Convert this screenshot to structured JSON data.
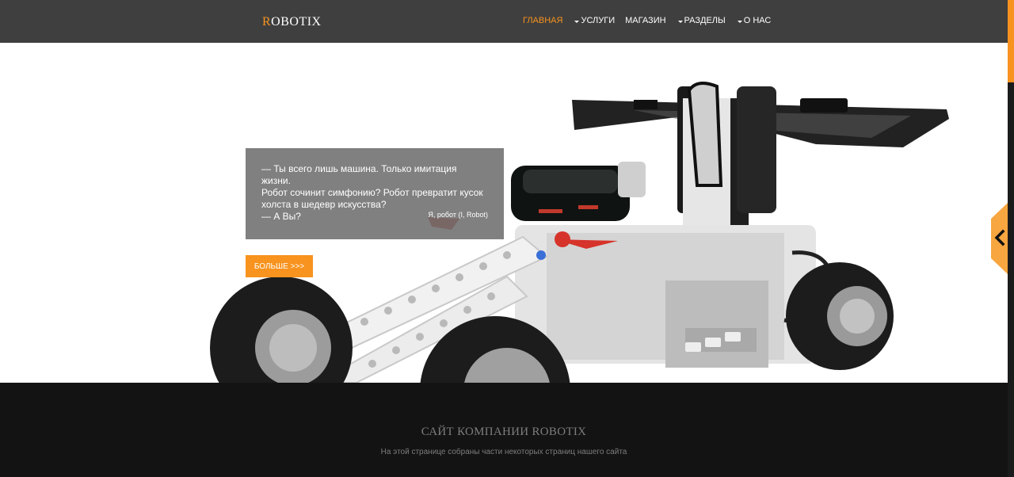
{
  "header": {
    "logo_first": "R",
    "logo_rest": "OBOTIX",
    "nav": [
      {
        "label": "ГЛАВНАЯ",
        "dropdown": false,
        "active": true
      },
      {
        "label": "УСЛУГИ",
        "dropdown": true,
        "active": false
      },
      {
        "label": "МАГАЗИН",
        "dropdown": false,
        "active": false
      },
      {
        "label": "РАЗДЕЛЫ",
        "dropdown": true,
        "active": false
      },
      {
        "label": "О НАС",
        "dropdown": true,
        "active": false
      }
    ]
  },
  "hero": {
    "quote_lines": [
      "— Ты всего лишь машина. Только имитация жизни.",
      "Робот сочинит симфонию? Робот превратит кусок",
      "холста в шедевр искусства?",
      "— А Вы?"
    ],
    "quote_source": "Я, робот (I, Robot)",
    "more_button": "БОЛЬШЕ >>>"
  },
  "footer": {
    "title": "САЙТ КОМПАНИИ ROBOTIX",
    "subtitle": "На этой странице собраны части некоторых страниц нашего сайта"
  },
  "colors": {
    "accent": "#f7931e",
    "header_bg": "#3f3f3f",
    "footer_bg": "#131313",
    "quote_bg": "#6e6e6e"
  },
  "icons": {
    "side_toggle": "chevron-left-icon",
    "nav_dropdown": "caret-down-icon"
  }
}
